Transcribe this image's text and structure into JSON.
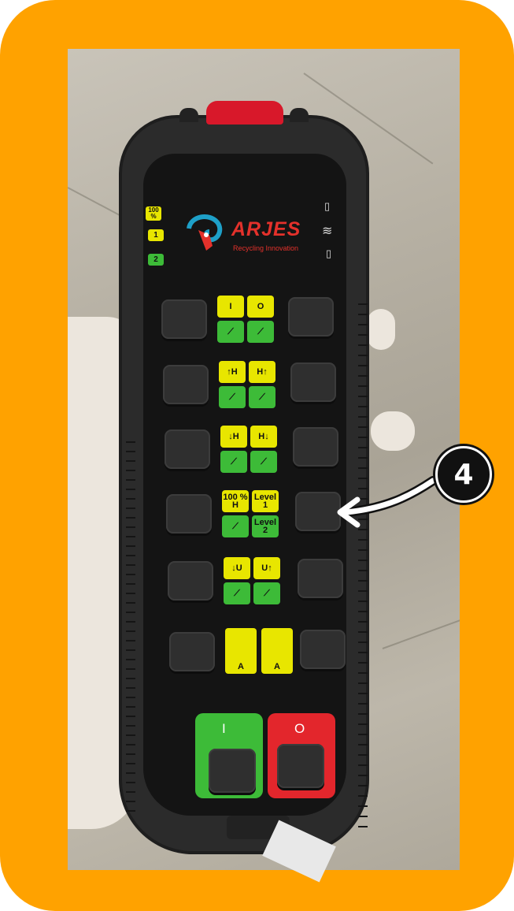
{
  "brand": {
    "name": "ARJES",
    "tagline": "Recycling Innovation"
  },
  "indicators": [
    "100 %",
    "1",
    "2"
  ],
  "status_icons": [
    "battery-icon",
    "wifi-icon",
    "battery-icon"
  ],
  "rows": [
    {
      "top": [
        "I",
        "O"
      ],
      "bottom": [
        "pedal-down-icon",
        "pedal-up-icon"
      ],
      "top_color": "yellow",
      "bottom_color": "green"
    },
    {
      "top": [
        "↑H",
        "H↑"
      ],
      "bottom": [
        "wheels-icon",
        "wheels-icon"
      ],
      "top_color": "yellow",
      "bottom_color": "green"
    },
    {
      "top": [
        "↓H",
        "H↓"
      ],
      "bottom": [
        "ramp-icon",
        "ramp-icon"
      ],
      "top_color": "yellow",
      "bottom_color": "green"
    },
    {
      "top": [
        "100 % H",
        "Level 1"
      ],
      "bottom": [
        "engine-icon",
        "Level 2"
      ],
      "top_color": "yellow",
      "bottom_color": "green"
    },
    {
      "top": [
        "↓U",
        "U↑"
      ],
      "bottom": [
        "arm-icon",
        "arm-icon"
      ],
      "top_color": "yellow",
      "bottom_color": "green"
    },
    {
      "top": [
        "A",
        "A"
      ],
      "bottom": [],
      "top_color": "yellow",
      "bottom_color": "yellow"
    }
  ],
  "main_buttons": {
    "start_symbol": "I",
    "stop_symbol": "O",
    "start_color": "#3dbb38",
    "stop_color": "#e3262c"
  },
  "callout": {
    "number": "4"
  },
  "colors": {
    "frame": "#ffa200",
    "label_yellow": "#e8e600",
    "label_green": "#3dbb38",
    "brand_red": "#e4312b"
  }
}
